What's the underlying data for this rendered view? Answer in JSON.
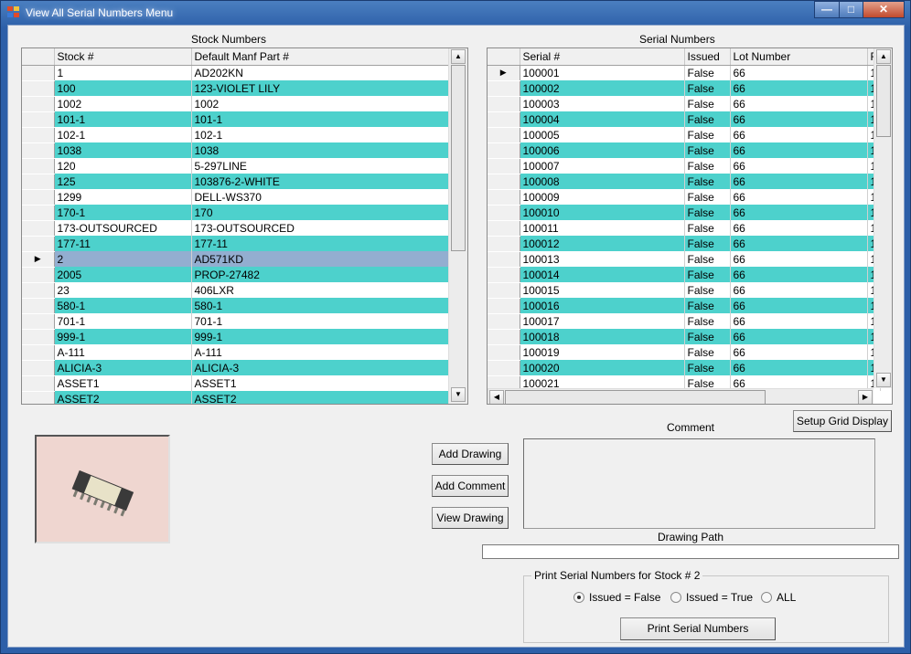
{
  "window": {
    "title": "View All Serial Numbers Menu",
    "controls": {
      "minimize": "—",
      "maximize": "□",
      "close": "✕"
    }
  },
  "colors": {
    "alt_row": "#4dd1cc",
    "selected_row": "#93aed0",
    "titlebar": "#2d5fa8"
  },
  "stock_grid": {
    "title": "Stock Numbers",
    "columns": [
      "Stock #",
      "Default Manf Part #"
    ],
    "selected_index": 12,
    "rows": [
      [
        "1",
        "AD202KN"
      ],
      [
        "100",
        "123-VIOLET LILY"
      ],
      [
        "1002",
        "1002"
      ],
      [
        "101-1",
        "101-1"
      ],
      [
        "102-1",
        "102-1"
      ],
      [
        "1038",
        "1038"
      ],
      [
        "120",
        "5-297LINE"
      ],
      [
        "125",
        "103876-2-WHITE"
      ],
      [
        "1299",
        "DELL-WS370"
      ],
      [
        "170-1",
        "170"
      ],
      [
        "173-OUTSOURCED",
        "173-OUTSOURCED"
      ],
      [
        "177-11",
        "177-11"
      ],
      [
        "2",
        "AD571KD"
      ],
      [
        "2005",
        "PROP-27482"
      ],
      [
        "23",
        "406LXR"
      ],
      [
        "580-1",
        "580-1"
      ],
      [
        "701-1",
        "701-1"
      ],
      [
        "999-1",
        "999-1"
      ],
      [
        "A-111",
        "A-111"
      ],
      [
        "ALICIA-3",
        "ALICIA-3"
      ],
      [
        "ASSET1",
        "ASSET1"
      ],
      [
        "ASSET2",
        "ASSET2"
      ]
    ]
  },
  "serial_grid": {
    "title": "Serial Numbers",
    "columns": [
      "Serial #",
      "Issued",
      "Lot Number",
      "F"
    ],
    "current_index": 0,
    "rows": [
      [
        "100001",
        "False",
        "66",
        "1"
      ],
      [
        "100002",
        "False",
        "66",
        "1"
      ],
      [
        "100003",
        "False",
        "66",
        "1"
      ],
      [
        "100004",
        "False",
        "66",
        "1"
      ],
      [
        "100005",
        "False",
        "66",
        "1"
      ],
      [
        "100006",
        "False",
        "66",
        "1"
      ],
      [
        "100007",
        "False",
        "66",
        "1"
      ],
      [
        "100008",
        "False",
        "66",
        "1"
      ],
      [
        "100009",
        "False",
        "66",
        "1"
      ],
      [
        "100010",
        "False",
        "66",
        "1"
      ],
      [
        "100011",
        "False",
        "66",
        "1"
      ],
      [
        "100012",
        "False",
        "66",
        "1"
      ],
      [
        "100013",
        "False",
        "66",
        "1"
      ],
      [
        "100014",
        "False",
        "66",
        "1"
      ],
      [
        "100015",
        "False",
        "66",
        "1"
      ],
      [
        "100016",
        "False",
        "66",
        "1"
      ],
      [
        "100017",
        "False",
        "66",
        "1"
      ],
      [
        "100018",
        "False",
        "66",
        "1"
      ],
      [
        "100019",
        "False",
        "66",
        "1"
      ],
      [
        "100020",
        "False",
        "66",
        "1"
      ],
      [
        "100021",
        "False",
        "66",
        "1"
      ]
    ]
  },
  "buttons": {
    "setup_grid": "Setup Grid Display",
    "add_drawing": "Add Drawing",
    "add_comment": "Add Comment",
    "view_drawing": "View Drawing",
    "print_serials": "Print Serial Numbers"
  },
  "comment": {
    "label": "Comment",
    "value": ""
  },
  "drawing_path": {
    "label": "Drawing Path",
    "value": ""
  },
  "print_group": {
    "title": "Print Serial Numbers for Stock # 2",
    "options": [
      {
        "label": "Issued = False",
        "checked": true
      },
      {
        "label": "Issued = True",
        "checked": false
      },
      {
        "label": "ALL",
        "checked": false
      }
    ]
  },
  "picture": {
    "description": "integrated-circuit-chip-photo"
  }
}
